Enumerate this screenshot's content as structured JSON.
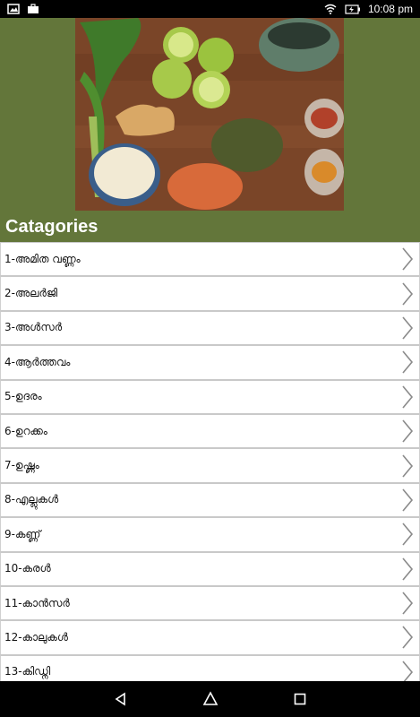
{
  "status_bar": {
    "time": "10:08 pm",
    "icons": [
      "image-icon",
      "briefcase-icon",
      "wifi-icon",
      "battery-icon"
    ]
  },
  "header": {
    "hero_image": "spices-and-herbs-photo",
    "title": "Catagories",
    "background_color": "#63763a"
  },
  "categories": [
    {
      "label": "1-അമിത വണ്ണം"
    },
    {
      "label": "2-അലർജി"
    },
    {
      "label": "3-അൾസർ"
    },
    {
      "label": "4-ആർത്തവം"
    },
    {
      "label": "5-ഉദരം"
    },
    {
      "label": "6-ഉറക്കം"
    },
    {
      "label": "7-ഉഷ്ണം"
    },
    {
      "label": "8-എല്ലുകൾ"
    },
    {
      "label": "9-കണ്ണ്"
    },
    {
      "label": "10-കരൾ"
    },
    {
      "label": "11-കാൻസർ"
    },
    {
      "label": "12-കാലുകൾ"
    },
    {
      "label": "13-കിഡ്നി"
    }
  ],
  "nav_bar": {
    "buttons": [
      "back-icon",
      "home-icon",
      "recents-icon"
    ]
  }
}
